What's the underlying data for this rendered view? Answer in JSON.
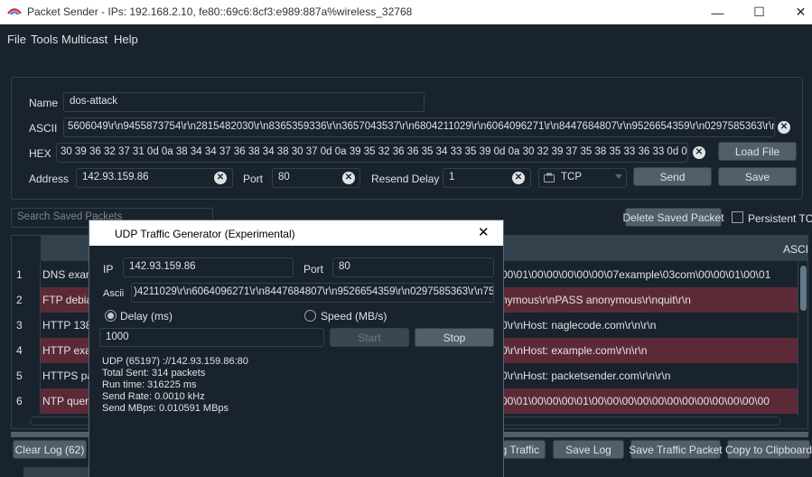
{
  "window": {
    "title": "Packet Sender - IPs: 192.168.2.10, fe80::69c6:8cf3:e989:887a%wireless_32768",
    "minimize": "—",
    "maximize": "☐",
    "close": "✕"
  },
  "menu": [
    "File",
    "Tools",
    "Multicast",
    "Help"
  ],
  "packet_form": {
    "name_label": "Name",
    "name_value": "dos-attack",
    "ascii_label": "ASCII",
    "ascii_value": "5606049\\r\\n9455873754\\r\\n2815482030\\r\\n8365359336\\r\\n3657043537\\r\\n6804211029\\r\\n6064096271\\r\\n8447684807\\r\\n9526654359\\r\\n0297585363\\r\\n75",
    "hex_label": "HEX",
    "hex_value": "30 39 36 32 37 31 0d 0a 38 34 34 37 36 38 34 38 30 37 0d 0a 39 35 32 36 36 35 34 33 35 39 0d 0a 30 32 39 37 35 38 35 33 36 33 0d 0a 37 35",
    "load_file": "Load File",
    "address_label": "Address",
    "address_value": "142.93.159.86",
    "port_label": "Port",
    "port_value": "80",
    "resend_label": "Resend Delay",
    "resend_value": "1",
    "protocol": "TCP",
    "send": "Send",
    "save": "Save"
  },
  "saved": {
    "search_placeholder": "Search Saved Packets",
    "delete_button": "Delete Saved Packet",
    "persistent_tcp": "Persistent TCP",
    "ascii_header": "ASCI",
    "rows": [
      {
        "num": "1",
        "name": "DNS exan",
        "ascii": "00\\01\\00\\00\\00\\00\\00\\07example\\03com\\00\\00\\01\\00\\01"
      },
      {
        "num": "2",
        "name": "FTP debia",
        "ascii": "nymous\\r\\nPASS anonymous\\r\\nquit\\r\\n"
      },
      {
        "num": "3",
        "name": "HTTP 138",
        "ascii": "0\\r\\nHost: naglecode.com\\r\\n\\r\\n"
      },
      {
        "num": "4",
        "name": "HTTP exa",
        "ascii": "0\\r\\nHost: example.com\\r\\n\\r\\n"
      },
      {
        "num": "5",
        "name": "HTTPS pa",
        "ascii": "0\\r\\nHost: packetsender.com\\r\\n\\r\\n"
      },
      {
        "num": "6",
        "name": "NTP quer",
        "ascii": "00\\01\\00\\00\\00\\01\\00\\00\\00\\00\\00\\00\\00\\00\\00\\00\\00\\00"
      }
    ]
  },
  "bottom": {
    "clear_log": "Clear Log (62)",
    "log_traffic": "g Traffic",
    "save_log": "Save Log",
    "save_traffic": "Save Traffic Packet",
    "copy_clipboard": "Copy to Clipboard"
  },
  "dialog": {
    "title": "UDP Traffic Generator (Experimental)",
    "close": "✕",
    "ip_label": "IP",
    "ip_value": "142.93.159.86",
    "port_label": "Port",
    "port_value": "80",
    "ascii_label": "Ascii",
    "ascii_value": ")4211029\\r\\n6064096271\\r\\n8447684807\\r\\n9526654359\\r\\n0297585363\\r\\n75",
    "delay_label": "Delay (ms)",
    "speed_label": "Speed (MB/s)",
    "delay_value": "1000",
    "start": "Start",
    "stop": "Stop",
    "stats": [
      "UDP (65197) ://142.93.159.86:80",
      "Total Sent: 314 packets",
      "Run time: 316225 ms",
      "Send Rate: 0.0010 kHz",
      "Send MBps: 0.010591 MBps"
    ]
  }
}
